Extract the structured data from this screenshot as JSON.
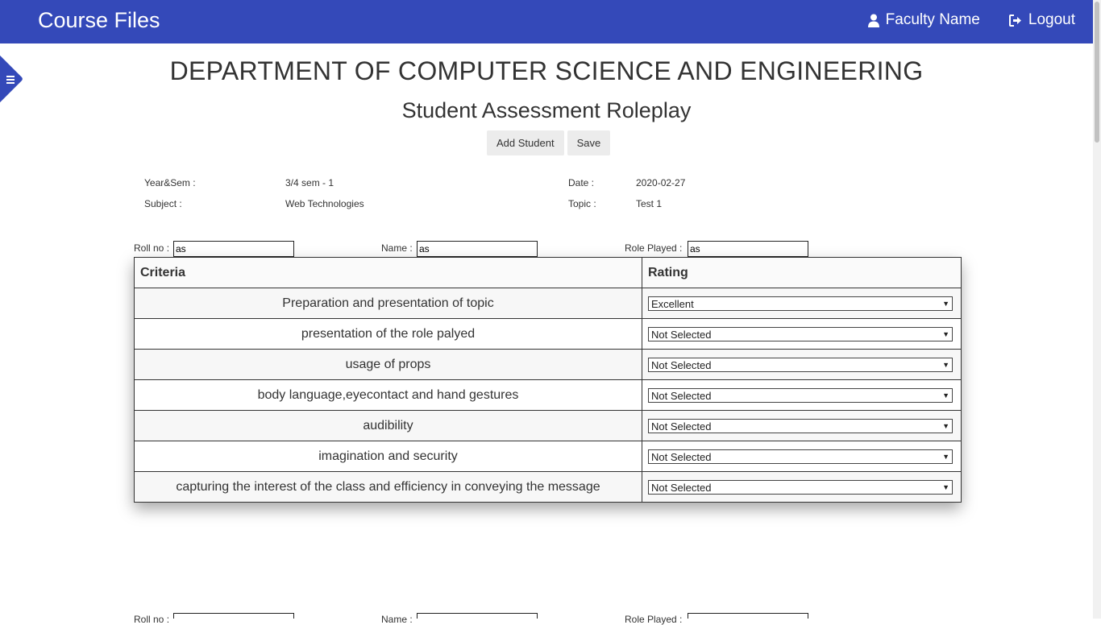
{
  "navbar": {
    "brand": "Course Files",
    "user_label": "Faculty Name",
    "logout_label": "Logout"
  },
  "header": {
    "department": "DEPARTMENT OF COMPUTER SCIENCE AND ENGINEERING",
    "title": "Student Assessment Roleplay",
    "add_student_label": "Add Student",
    "save_label": "Save"
  },
  "info": {
    "year_sem_label": "Year&Sem :",
    "year_sem_value": "3/4 sem - 1",
    "subject_label": "Subject :",
    "subject_value": "Web Technologies",
    "date_label": "Date :",
    "date_value": "2020-02-27",
    "topic_label": "Topic :",
    "topic_value": "Test 1"
  },
  "student1": {
    "roll_label": "Roll no :",
    "roll_value": "as",
    "name_label": "Name :",
    "name_value": "as",
    "role_label": "Role Played :",
    "role_value": "as"
  },
  "table": {
    "headers": [
      "Criteria",
      "Rating"
    ],
    "rows": [
      {
        "criteria": "Preparation and presentation of topic",
        "rating": "Excellent"
      },
      {
        "criteria": "presentation of the role palyed",
        "rating": "Not Selected"
      },
      {
        "criteria": "usage of props",
        "rating": "Not Selected"
      },
      {
        "criteria": "body language,eyecontact and hand gestures",
        "rating": "Not Selected"
      },
      {
        "criteria": "audibility",
        "rating": "Not Selected"
      },
      {
        "criteria": "imagination and security",
        "rating": "Not Selected"
      },
      {
        "criteria": "capturing the interest of the class and efficiency in conveying the message",
        "rating": "Not Selected"
      }
    ]
  },
  "student2": {
    "roll_label": "Roll no :",
    "name_label": "Name :",
    "role_label": "Role Played :"
  },
  "icons": {
    "user": "user-icon",
    "logout": "sign-out-icon",
    "menu": "menu-icon",
    "dropdown": "caret-down-icon"
  },
  "colors": {
    "brand": "#3449b9"
  }
}
